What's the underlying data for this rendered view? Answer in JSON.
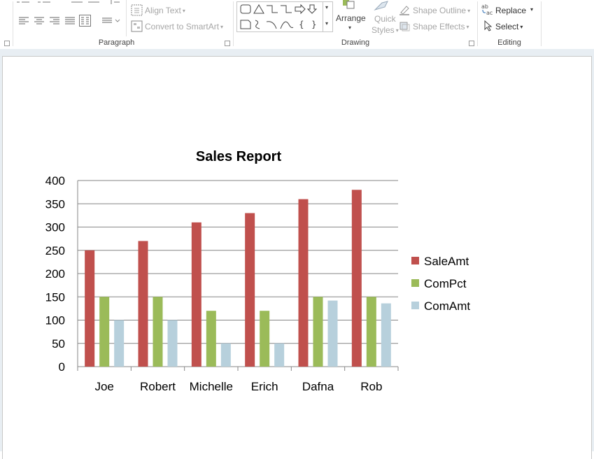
{
  "ribbon": {
    "paragraph": {
      "label": "Paragraph",
      "align_text_label": "Align Text",
      "convert_smartart_label": "Convert to SmartArt"
    },
    "drawing": {
      "label": "Drawing",
      "arrange_label": "Arrange",
      "quick_styles_line1": "Quick",
      "quick_styles_line2": "Styles",
      "shape_outline_label": "Shape Outline",
      "shape_effects_label": "Shape Effects"
    },
    "editing": {
      "label": "Editing",
      "replace_label": "Replace",
      "select_label": "Select"
    }
  },
  "chart_data": {
    "type": "bar",
    "title": "Sales Report",
    "categories": [
      "Joe",
      "Robert",
      "Michelle",
      "Erich",
      "Dafna",
      "Rob"
    ],
    "series": [
      {
        "name": "SaleAmt",
        "color": "#c0504d",
        "values": [
          250,
          270,
          310,
          330,
          360,
          380
        ]
      },
      {
        "name": "ComPct",
        "color": "#9bbb59",
        "values": [
          150,
          150,
          120,
          120,
          150,
          150
        ]
      },
      {
        "name": "ComAmt",
        "color": "#b7d0dc",
        "values": [
          100,
          100,
          50,
          50,
          142,
          136
        ]
      }
    ],
    "ylim": [
      0,
      400
    ],
    "yticks": [
      0,
      50,
      100,
      150,
      200,
      250,
      300,
      350,
      400
    ],
    "grid": true,
    "legend": "right"
  }
}
